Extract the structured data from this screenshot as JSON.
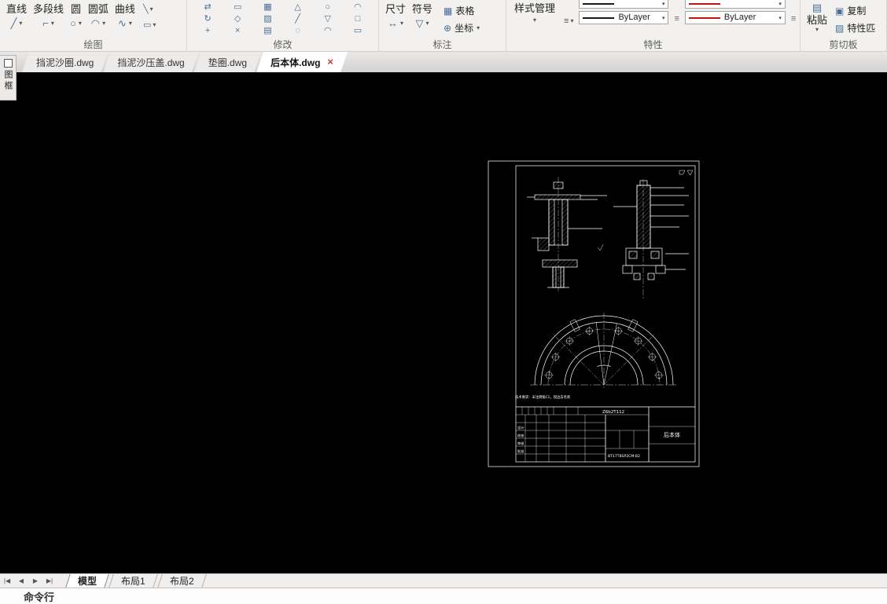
{
  "colors": {
    "canvas_bg": "#000000",
    "drawing_stroke": "#ffffff",
    "linetype_sample": "#1a1a1a",
    "color_sample": "#cc1111",
    "close_red": "#c0392b"
  },
  "icons": {
    "dropdown": "▾",
    "line": "╱",
    "polyline": "⌐",
    "circle": "○",
    "arc": "◠",
    "curve": "∿",
    "pencil": "╲",
    "rect": "▭",
    "dim": "↔",
    "symbol": "▽",
    "table": "▦",
    "coord": "⊕",
    "menu": "≡",
    "paste": "▤",
    "copy": "▣",
    "match": "▨",
    "nav_first": "|◀",
    "nav_prev": "◀",
    "nav_next": "▶",
    "nav_last": "▶|"
  },
  "ribbon": {
    "groups": [
      {
        "label": "绘图"
      },
      {
        "label": "修改"
      },
      {
        "label": "标注"
      },
      {
        "label": "特性"
      },
      {
        "label": "剪切板"
      }
    ],
    "draw_tools": [
      {
        "label": "直线"
      },
      {
        "label": "多段线"
      },
      {
        "label": "圆"
      },
      {
        "label": "圆弧"
      },
      {
        "label": "曲线"
      }
    ],
    "modify_icons": [
      "⇄",
      "▭",
      "▦",
      "△",
      "○",
      "◠",
      "↻",
      "◇",
      "▨",
      "╱",
      "▽",
      "□",
      "+",
      "×",
      "▤",
      "◌",
      "◠",
      "▭"
    ],
    "annotate_tools": [
      {
        "label": "尺寸"
      },
      {
        "label": "符号"
      },
      {
        "label": "表格"
      },
      {
        "label": "坐标"
      }
    ],
    "properties": {
      "style_manager_label": "样式管理",
      "linetype_value": "ByLayer",
      "color_value": "ByLayer"
    },
    "clipboard": {
      "paste_label": "粘贴",
      "copy_label": "复制",
      "match_label": "特性匹"
    }
  },
  "file_tabs": [
    {
      "label": "挡泥沙圈.dwg"
    },
    {
      "label": "挡泥沙压盖.dwg"
    },
    {
      "label": "垫圈.dwg"
    },
    {
      "label": "后本体.dwg"
    }
  ],
  "tab_close": "×",
  "side_panel": {
    "label": "图框"
  },
  "drawing": {
    "notes": "技术要求：未注倒角C1，锐边去毛刺",
    "title_block": {
      "code": "Z6b2T112",
      "part_name": "后本体",
      "drawing_no": "BT17T8SP2CM-B2",
      "sign_labels": [
        "设计",
        "校核",
        "审核",
        "批准"
      ]
    }
  },
  "layout_tabs": [
    {
      "label": "模型"
    },
    {
      "label": "布局1"
    },
    {
      "label": "布局2"
    }
  ],
  "command_bar": {
    "label": "命令行"
  }
}
